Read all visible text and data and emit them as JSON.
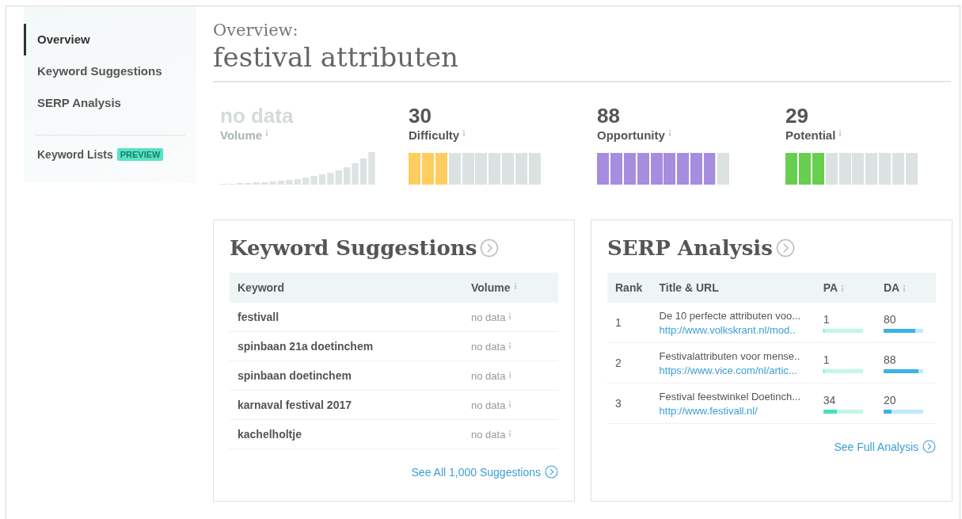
{
  "sidebar": {
    "items": [
      {
        "label": "Overview",
        "selected": true
      },
      {
        "label": "Keyword Suggestions",
        "selected": false
      },
      {
        "label": "SERP Analysis",
        "selected": false
      }
    ],
    "lists_link": {
      "label": "Keyword Lists",
      "badge": "PREVIEW"
    }
  },
  "header": {
    "eyebrow": "Overview:",
    "title": "festival attributen"
  },
  "metrics": [
    {
      "kind": "sparkline",
      "value": "no data",
      "label": "Volume"
    },
    {
      "kind": "segments",
      "value": "30",
      "label": "Difficulty",
      "level": 0.3,
      "color": "#fdcd5f"
    },
    {
      "kind": "segments",
      "value": "88",
      "label": "Opportunity",
      "level": 0.88,
      "color": "#a68ddf"
    },
    {
      "kind": "segments",
      "value": "29",
      "label": "Potential",
      "level": 0.29,
      "color": "#66cf4e"
    }
  ],
  "keyword_suggestions": {
    "title": "Keyword Suggestions",
    "columns": [
      "Keyword",
      "Volume"
    ],
    "rows": [
      {
        "keyword": "festivall",
        "volume": "no data"
      },
      {
        "keyword": "spinbaan 21a doetinchem",
        "volume": "no data"
      },
      {
        "keyword": "spinbaan doetinchem",
        "volume": "no data"
      },
      {
        "keyword": "karnaval festival 2017",
        "volume": "no data"
      },
      {
        "keyword": "kachelholtje",
        "volume": "no data"
      }
    ],
    "link": "See All 1,000 Suggestions"
  },
  "serp_analysis": {
    "title": "SERP Analysis",
    "columns": [
      "Rank",
      "Title & URL",
      "PA",
      "DA"
    ],
    "rows": [
      {
        "rank": "1",
        "title": "De 10 perfecte attributen voo...",
        "url": "http://www.volkskrant.nl/mod..",
        "pa": "1",
        "pa_level": {
          "level": 0.01
        },
        "da": "80",
        "da_level": {
          "level": 0.8
        }
      },
      {
        "rank": "2",
        "title": "Festivalattributen voor mense..",
        "url": "https://www.vice.com/nl/artic...",
        "pa": "1",
        "pa_level": {
          "level": 0.01
        },
        "da": "88",
        "da_level": {
          "level": 0.88
        }
      },
      {
        "rank": "3",
        "title": "Festival feestwinkel Doetinch...",
        "url": "http://www.festivall.nl/",
        "pa": "34",
        "pa_level": {
          "level": 0.34
        },
        "da": "20",
        "da_level": {
          "level": 0.2
        }
      }
    ],
    "link": "See Full Analysis"
  }
}
